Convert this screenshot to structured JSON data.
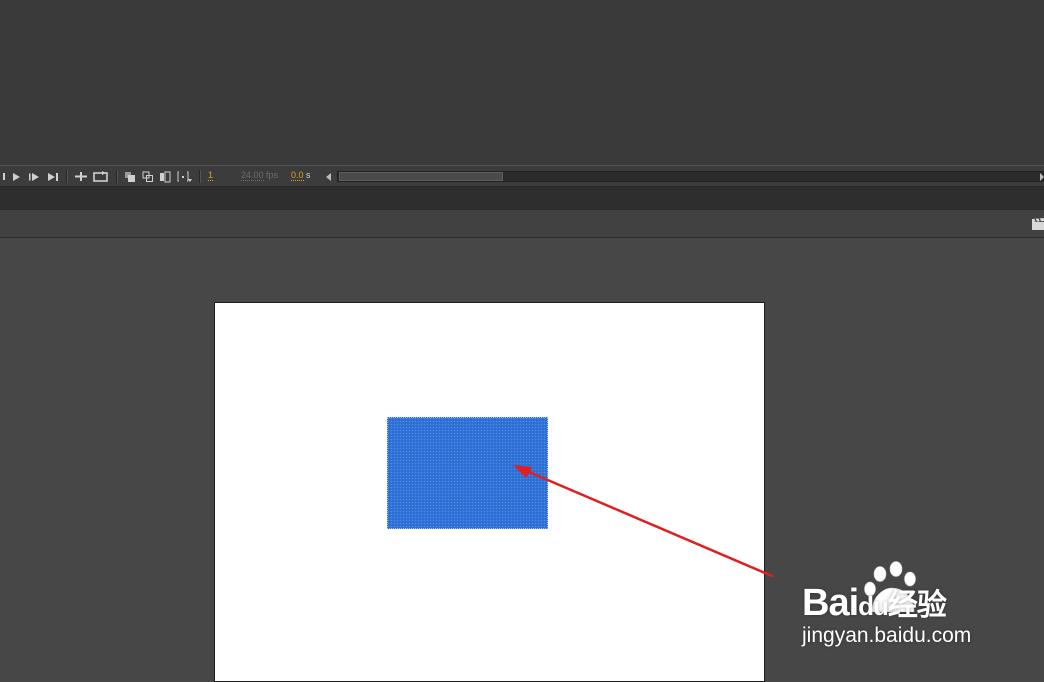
{
  "timeline": {
    "current_frame": "1",
    "fps_value": "24.00",
    "fps_unit": "fps",
    "time_value": "0.0",
    "time_unit": "s",
    "buttons": [
      {
        "name": "step-back-button"
      },
      {
        "name": "play-button"
      },
      {
        "name": "step-forward-button"
      },
      {
        "name": "go-to-last-frame-button"
      },
      {
        "name": "center-frame-button"
      },
      {
        "name": "loop-button"
      },
      {
        "name": "onion-skin-button"
      },
      {
        "name": "onion-skin-outlines-button"
      },
      {
        "name": "edit-multiple-frames-button"
      },
      {
        "name": "modify-onion-markers-button"
      }
    ],
    "scrollbar_thumb_fraction": 0.23
  },
  "stage": {
    "canvas_color": "#ffffff",
    "shape": {
      "type": "rectangle",
      "fill": "#2a6ed6",
      "state": "selected"
    },
    "annotation": {
      "type": "arrow",
      "color": "#e02020",
      "points_to": "rectangle"
    }
  },
  "watermark": {
    "brand_left": "Bai",
    "brand_right": "经验",
    "brand_paw": "du",
    "url": "jingyan.baidu.com"
  },
  "colors": {
    "accent_orange": "#e0a020",
    "panel_bg": "#3a3a3a",
    "stage_bg": "#474747"
  }
}
